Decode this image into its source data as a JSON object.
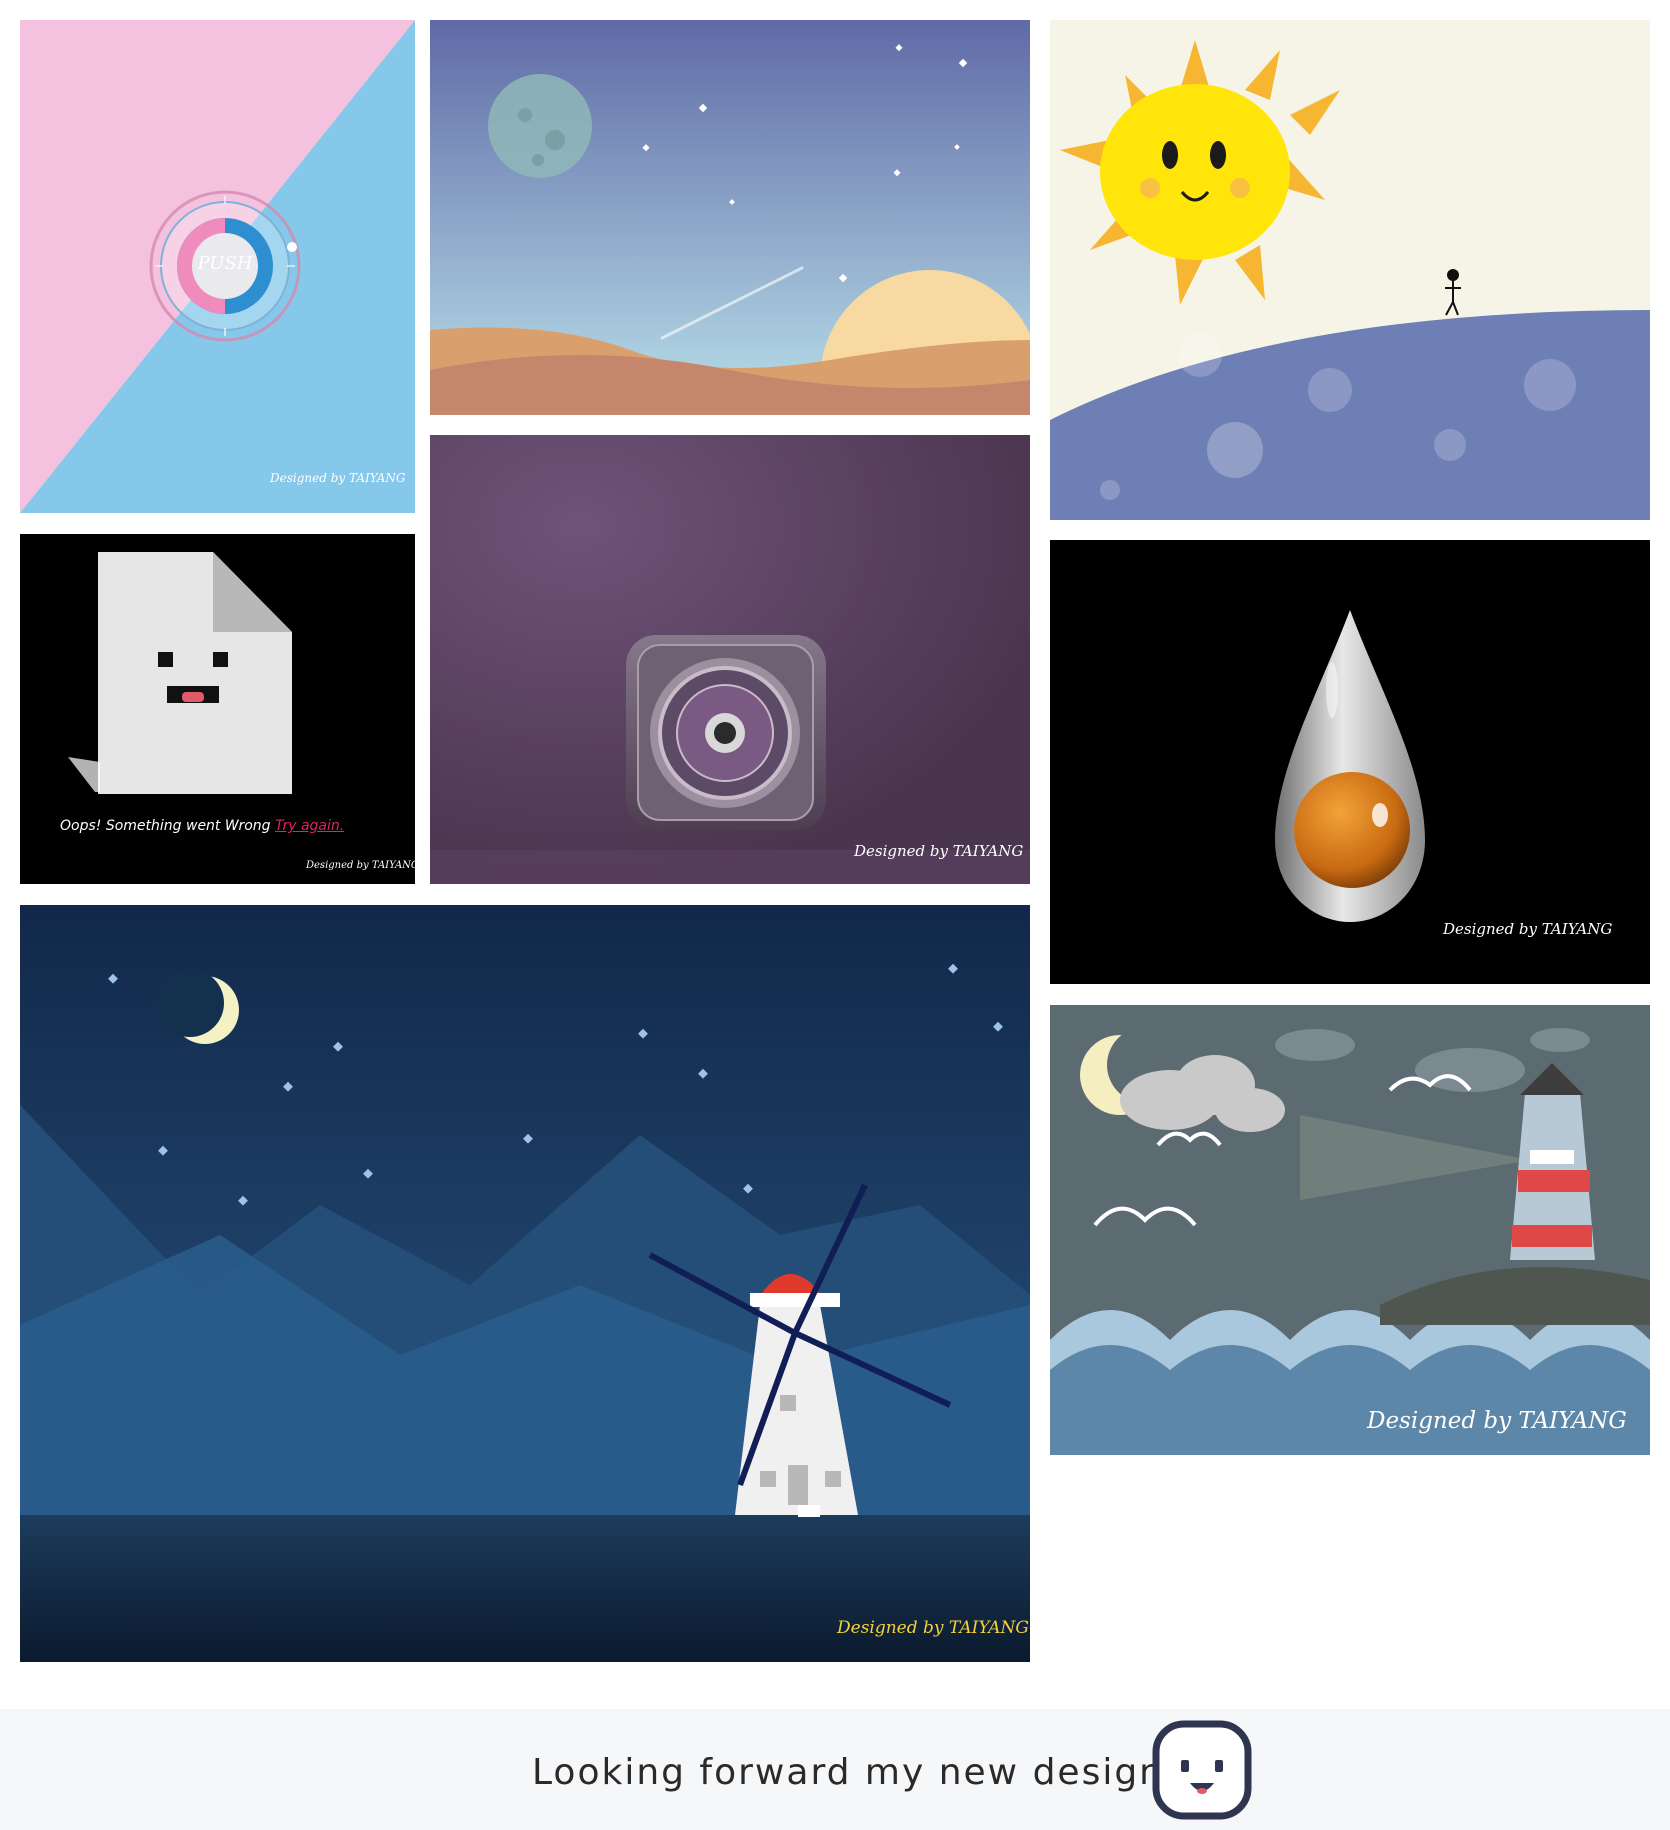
{
  "gallery": {
    "items": [
      {
        "id": "push-clock",
        "button_label": "PUSH",
        "credit": "Designed by TAIYANG"
      },
      {
        "id": "desert-night",
        "credit": ""
      },
      {
        "id": "sun-hill",
        "credit": ""
      },
      {
        "id": "error-page",
        "message": "Oops! Something went Wrong",
        "link": "Try again.",
        "credit": "Designed by TAIYANG"
      },
      {
        "id": "camera-icon",
        "credit": "Designed by TAIYANG"
      },
      {
        "id": "water-drop",
        "credit": "Designed by TAIYANG"
      },
      {
        "id": "windmill-night",
        "credit": "Designed by TAIYANG"
      },
      {
        "id": "lighthouse",
        "credit": "Designed by TAIYANG"
      }
    ]
  },
  "footer": {
    "text": "Looking forward my new design!"
  },
  "colors": {
    "footer_bg": "#f6f7f9",
    "link": "#e0245e",
    "windmill_credit": "#f2d23a"
  }
}
